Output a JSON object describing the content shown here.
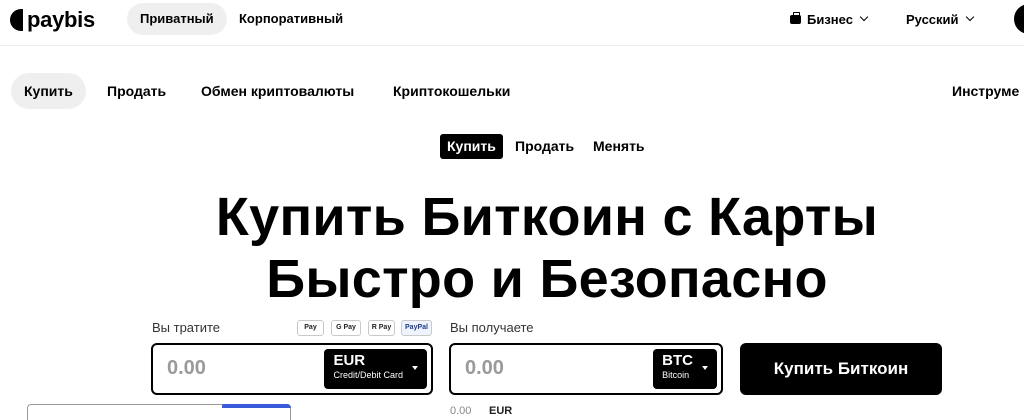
{
  "header": {
    "logo_text": "paybis",
    "segments": {
      "private": "Приватный",
      "corporate": "Корпоративный"
    },
    "business": "Бизнес",
    "language": "Русский"
  },
  "nav": {
    "buy": "Купить",
    "sell": "Продать",
    "exchange": "Обмен криптовалюты",
    "wallets": "Криптокошельки",
    "tools": "Инструме"
  },
  "mode_tabs": {
    "buy": "Купить",
    "sell": "Продать",
    "swap": "Менять"
  },
  "heading": {
    "line1": "Купить Биткоин с Карты",
    "line2": "Быстро и Безопасно"
  },
  "spend": {
    "label": "Вы тратите",
    "amount": "0.00",
    "currency": "EUR",
    "method": "Credit/Debit Card",
    "payment_badges": [
      "Pay",
      "G Pay",
      "R Pay",
      "PayPal"
    ]
  },
  "receive": {
    "label": "Вы получаете",
    "amount": "0.00",
    "currency": "BTC",
    "currency_name": "Bitcoin"
  },
  "cta": "Купить Биткоин",
  "rate": {
    "value": "0.00",
    "currency": "EUR"
  },
  "colors": {
    "accent": "#000000",
    "muted": "#9a9a9a",
    "highlight": "#3a5bd9"
  }
}
